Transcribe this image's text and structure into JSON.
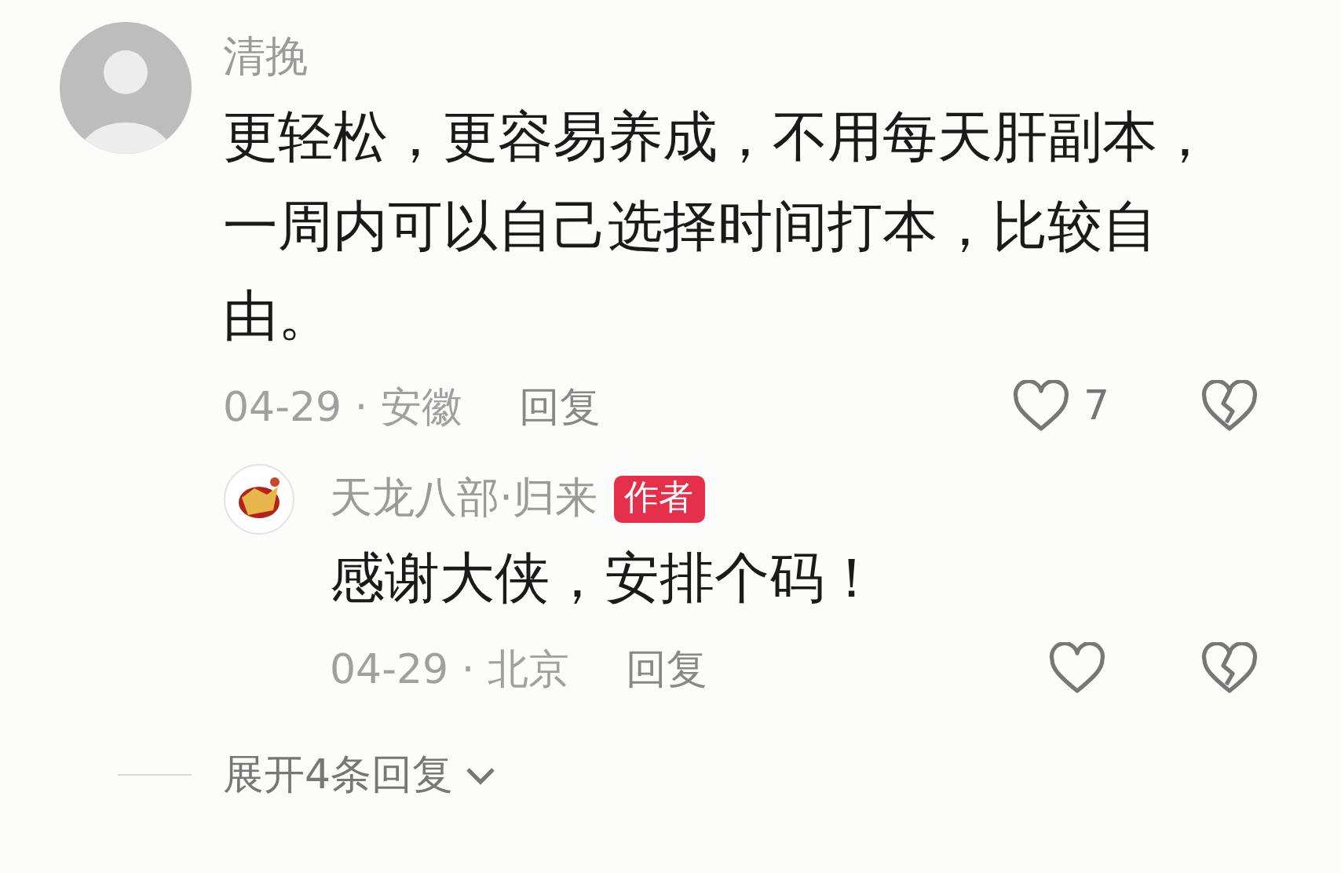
{
  "comment": {
    "author": "清挽",
    "text": "更轻松，更容易养成，不用每天肝副本，一周内可以自己选择时间打本，比较自由。",
    "date_location": "04-29 · 安徽",
    "reply_label": "回复",
    "like_count": "7",
    "replies": [
      {
        "author": "天龙八部·归来",
        "badge": "作者",
        "text": "感谢大侠，安排个码！",
        "date_location": "04-29 · 北京",
        "reply_label": "回复"
      }
    ],
    "expand_label": "展开4条回复"
  }
}
